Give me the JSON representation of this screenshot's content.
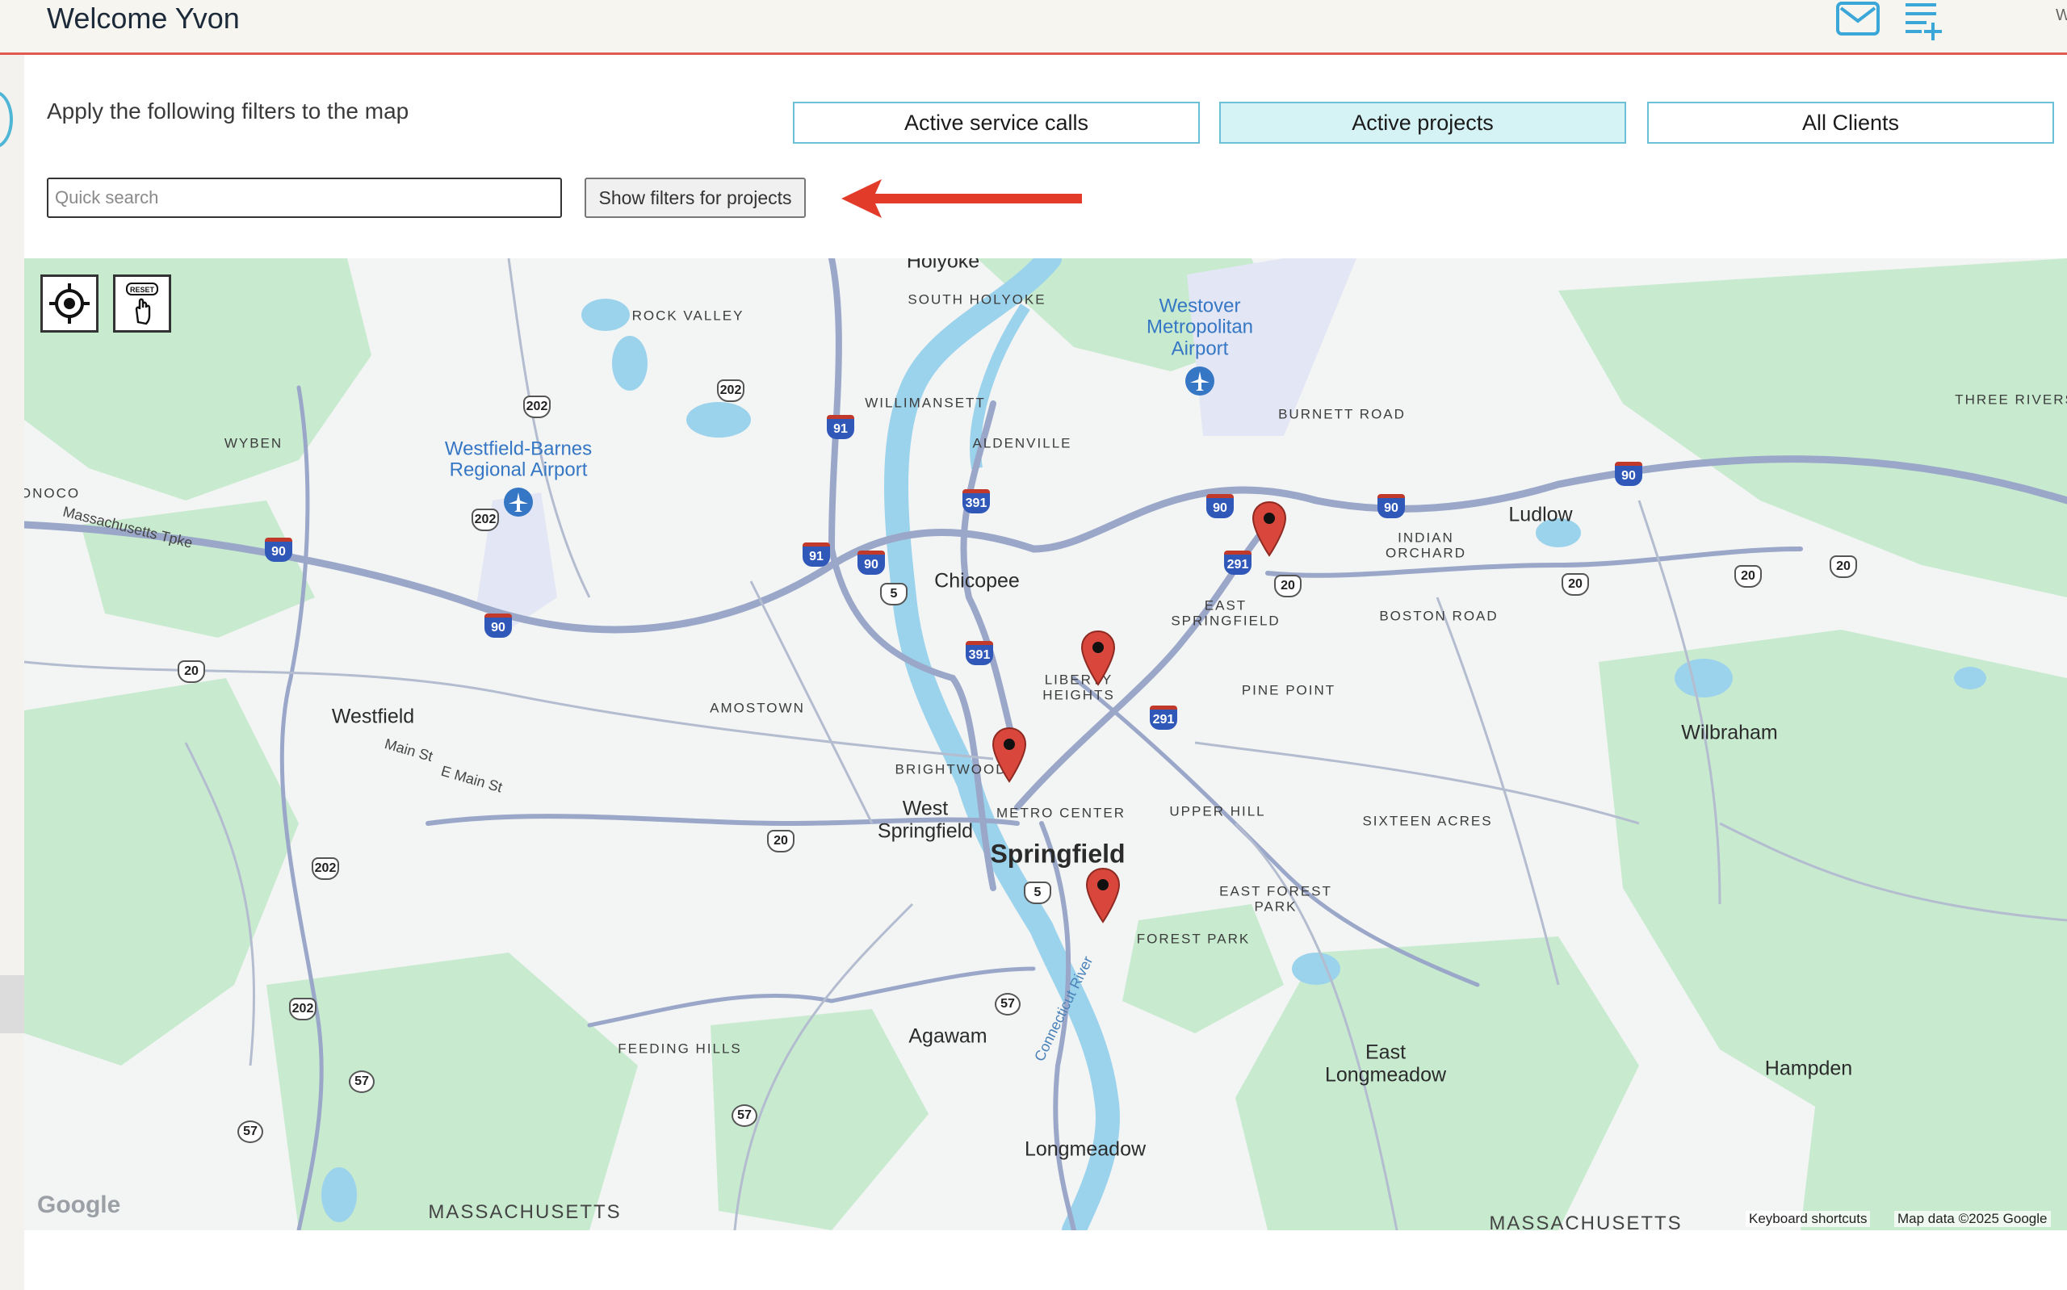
{
  "header": {
    "welcome": "Welcome Yvon",
    "corner_letter": "W",
    "mail_icon": "mail-icon",
    "add_list_icon": "playlist-add-icon",
    "border_color": "#e05a4f"
  },
  "filters": {
    "subtitle": "Apply the following filters to the map",
    "buttons": [
      {
        "label": "Active service calls",
        "active": false
      },
      {
        "label": "Active projects",
        "active": true
      },
      {
        "label": "All Clients",
        "active": false
      }
    ],
    "accent_color": "#6cbfd8",
    "active_bg": "#d5f2f5"
  },
  "search": {
    "placeholder": "Quick search",
    "value": ""
  },
  "show_filters_label": "Show filters for projects",
  "annotation": {
    "arrow_icon": "red-arrow-icon",
    "color": "#e23b2a"
  },
  "map": {
    "controls": {
      "locate_icon": "crosshair-locate-icon",
      "reset_label": "RESET",
      "reset_icon": "hand-pointer-icon"
    },
    "places": {
      "holyoke": "Holyoke",
      "south_holyoke": "SOUTH HOLYOKE",
      "rock_valley": "ROCK VALLEY",
      "westover": "Westover\nMetropolitan\nAirport",
      "burnett_road": "BURNETT ROAD",
      "three_rivers": "THREE RIVERS",
      "wyben": "WYBEN",
      "westfield_barnes": "Westfield-Barnes\nRegional Airport",
      "williamansett": "WILLIMANSETT",
      "aldenville": "ALDENVILLE",
      "onoco": "ONOCO",
      "mass_tpke": "Massachusetts Tpke",
      "ludlow": "Ludlow",
      "indian_orchard": "INDIAN\nORCHARD",
      "chicopee": "Chicopee",
      "east_springfield": "EAST\nSPRINGFIELD",
      "boston_road": "BOSTON ROAD",
      "liberty_heights": "LIBERTY\nHEIGHTS",
      "pine_point": "PINE POINT",
      "westfield": "Westfield",
      "amostown": "AMOSTOWN",
      "wilbraham": "Wilbraham",
      "main_st": "Main St",
      "e_main_st": "E Main St",
      "brightwood": "BRIGHTWOOD",
      "west_springfield": "West\nSpringfield",
      "metro_center": "METRO CENTER",
      "upper_hill": "UPPER HILL",
      "sixteen_acres": "SIXTEEN ACRES",
      "springfield": "Springfield",
      "east_forest_park": "EAST FOREST\nPARK",
      "forest_park": "FOREST PARK",
      "connecticut_river": "Connecticut River",
      "agawam": "Agawam",
      "feeding_hills": "FEEDING HILLS",
      "east_longmeadow": "East\nLongmeadow",
      "hampden": "Hampden",
      "longmeadow": "Longmeadow",
      "massachusetts": "MASSACHUSETTS",
      "massachusetts_2": "MASSACHUSETTS"
    },
    "shields": {
      "i90": "90",
      "i91": "91",
      "i391": "391",
      "i291": "291",
      "us20": "20",
      "us202": "202",
      "us5": "5",
      "rt57": "57"
    },
    "google_logo": "Google",
    "keyboard_shortcuts": "Keyboard shortcuts",
    "map_data": "Map data ©2025 Google",
    "pin_color": "#d9473c",
    "water_color": "#9cd3ec",
    "green_color": "#c8ebd0",
    "road_color": "#9aa7c9"
  }
}
